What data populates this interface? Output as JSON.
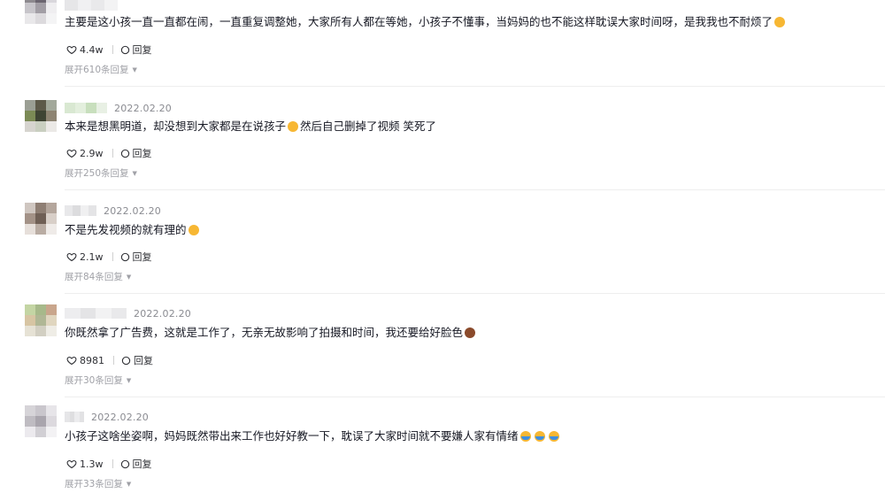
{
  "comments": [
    {
      "date": "",
      "text": "主要是这小孩一直一直都在闹，一直重复调整她，大家所有人都在等她，小孩子不懂事，当妈妈的也不能这样耽误大家时间呀，是我我也不耐烦了",
      "emoji": [
        "smile-emoji"
      ],
      "likes": "4.4w",
      "reply_label": "回复",
      "expand": "展开610条回复",
      "avatar_colors": [
        "#8d8a8f",
        "#6b6570",
        "#d9d7dc",
        "#c7c5ca",
        "#a29ea5",
        "#efeef0",
        "#e9e8ea",
        "#dcdadd",
        "#f4f4f5"
      ],
      "name_colors": [
        "#e6e6e8",
        "#f0f0f2",
        "#e9e9eb",
        "#f3f3f4"
      ]
    },
    {
      "date": "2022.02.20",
      "text": "本来是想黑明道，却没想到大家都是在说孩子",
      "text_after": "然后自己删掉了视频 笑死了",
      "emoji": [
        "smile-emoji"
      ],
      "likes": "2.9w",
      "reply_label": "回复",
      "expand": "展开250条回复",
      "avatar_colors": [
        "#9b9f94",
        "#5d5a49",
        "#a2a89a",
        "#7b8a55",
        "#3e4433",
        "#8d8472",
        "#d6d4cf",
        "#c9cfc0",
        "#ebe9e6"
      ],
      "name_colors": [
        "#d9e8d2",
        "#e3efdd",
        "#c8dfbd",
        "#e8f0e4"
      ]
    },
    {
      "date": "2022.02.20",
      "text": "不是先发视频的就有理的",
      "emoji": [
        "laugh-emoji"
      ],
      "likes": "2.1w",
      "reply_label": "回复",
      "expand": "展开84条回复",
      "avatar_colors": [
        "#cfc6c0",
        "#8e7e73",
        "#b4a69c",
        "#a39287",
        "#6f5f55",
        "#d8cfc8",
        "#e6dfda",
        "#b9aca3",
        "#efebe8"
      ],
      "name_colors": [
        "#e8e8ea",
        "#dcdcde",
        "#f0f0f1",
        "#e4e4e6"
      ]
    },
    {
      "date": "2022.02.20",
      "text": "你既然拿了广告费，这就是工作了，无亲无故影响了拍摄和时间，我还要给好脸色",
      "emoji": [
        "face-brown-emoji"
      ],
      "likes": "8981",
      "reply_label": "回复",
      "expand": "展开30条回复",
      "avatar_colors": [
        "#c4d5a4",
        "#a7b98a",
        "#c9a68c",
        "#d7c5a3",
        "#b0b795",
        "#e0d6bf",
        "#e6e2d5",
        "#d2cfc2",
        "#efede6"
      ],
      "name_colors": [
        "#ededef",
        "#e4e4e6",
        "#f2f2f3",
        "#e9e9eb"
      ]
    },
    {
      "date": "2022.02.20",
      "text": "小孩子这啥坐姿啊，妈妈既然带出来工作也好好教一下，耽误了大家时间就不要嫌人家有情绪",
      "emoji": [
        "tears-of-joy-emoji",
        "tears-of-joy-emoji",
        "tears-of-joy-emoji"
      ],
      "likes": "1.3w",
      "reply_label": "回复",
      "expand": "展开33条回复",
      "avatar_colors": [
        "#d6d4d8",
        "#c9c6cc",
        "#e7e5e9",
        "#bfbcc2",
        "#a9a5ad",
        "#dcd9de",
        "#eceaee",
        "#d1cfd4",
        "#f3f2f4"
      ],
      "name_colors": [
        "#e6e6e8",
        "#dedee0",
        "#ececee",
        "#e2e2e4"
      ]
    }
  ]
}
